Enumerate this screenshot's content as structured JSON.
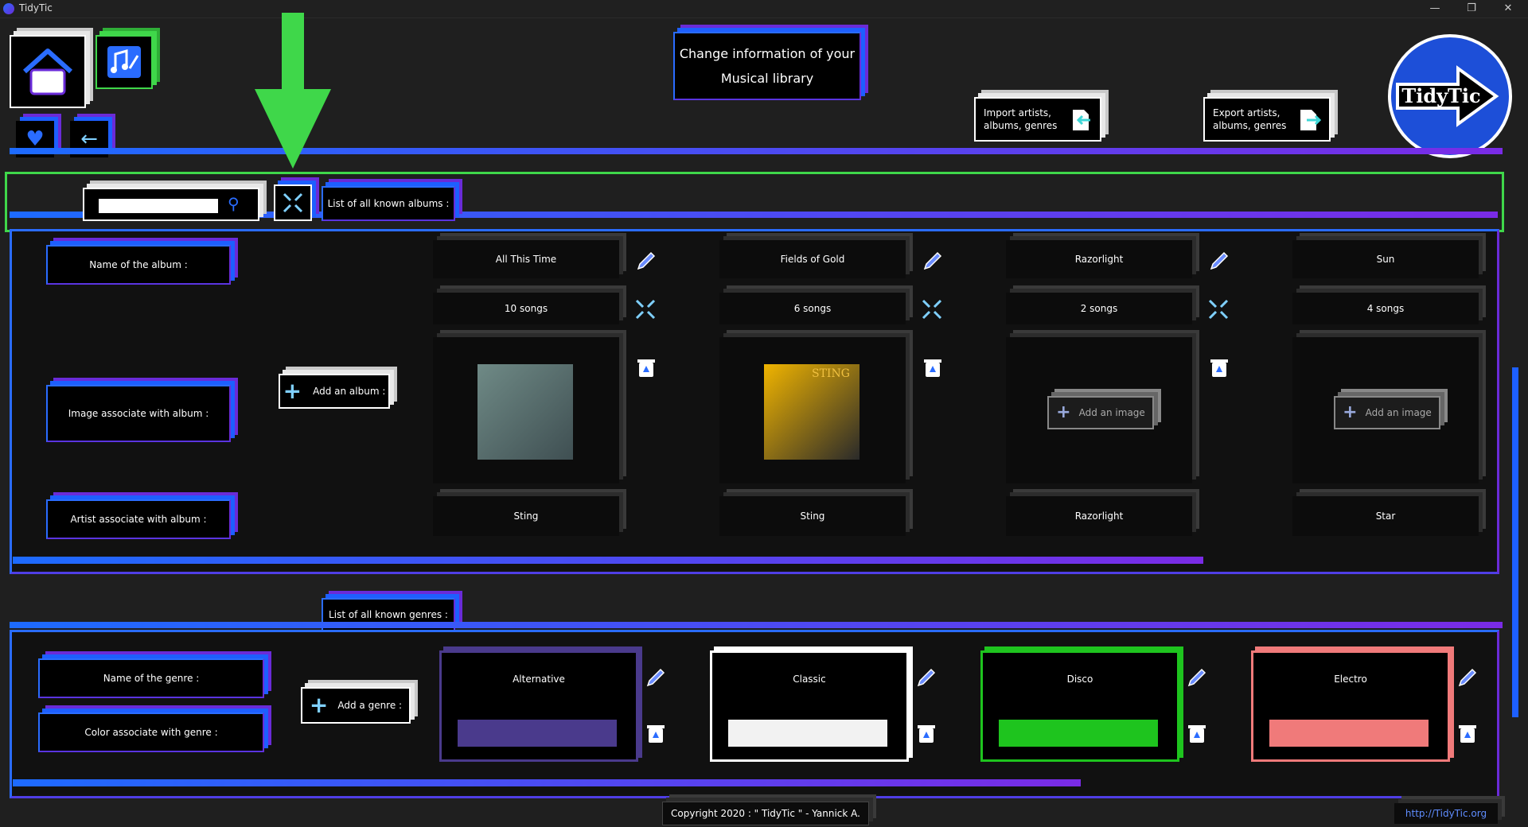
{
  "window": {
    "title": "TidyTic",
    "controls": [
      "—",
      "❐",
      "✕"
    ]
  },
  "header": {
    "banner_line1": "Change information of your",
    "banner_line2": "Musical library",
    "import_label_1": "Import artists,",
    "import_label_2": "albums, genres",
    "export_label_1": "Export artists,",
    "export_label_2": "albums, genres",
    "logo_text": "TidyTic"
  },
  "albums_section": {
    "tab_label": "List of all known albums :",
    "search": {
      "value": "",
      "placeholder": ""
    },
    "row_labels": {
      "name": "Name of the album :",
      "image": "Image associate with album :",
      "artist": "Artist associate with album :"
    },
    "add_album_label": "Add an album :",
    "add_image_label": "Add an image",
    "scroll_fraction": 0.82,
    "albums": [
      {
        "name": "All This Time",
        "songs": "10 songs",
        "artist": "Sting",
        "has_image": true,
        "cover_colors": [
          "#6f8a86",
          "#3f4f52"
        ]
      },
      {
        "name": "Fields of Gold",
        "songs": "6 songs",
        "artist": "Sting",
        "has_image": true,
        "cover_colors": [
          "#f0b400",
          "#2a2a2a"
        ],
        "cover_text": "STING"
      },
      {
        "name": "Razorlight",
        "songs": "2 songs",
        "artist": "Razorlight",
        "has_image": false
      },
      {
        "name": "Sun",
        "songs": "4 songs",
        "artist": "Star",
        "has_image": false
      }
    ]
  },
  "genres_section": {
    "tab_label": "List of all known genres :",
    "row_labels": {
      "name": "Name of the genre :",
      "color": "Color associate with genre :"
    },
    "add_genre_label": "Add a genre :",
    "scroll_fraction": 0.72,
    "genres": [
      {
        "name": "Alternative",
        "color": "#4a3a8c",
        "border": "#4a3a8c"
      },
      {
        "name": "Classic",
        "color": "#f2f2f2",
        "border": "#ffffff"
      },
      {
        "name": "Disco",
        "color": "#1ec41e",
        "border": "#1ec41e"
      },
      {
        "name": "Electro",
        "color": "#f07a7a",
        "border": "#f07a7a"
      }
    ]
  },
  "footer": {
    "copyright": "Copyright 2020 : \" TidyTic \" - Yannick A.",
    "link": "http://TidyTic.org"
  },
  "colors": {
    "accent_blue": "#1d6bff",
    "accent_purple": "#6a2bd8",
    "highlight_green": "#3fd74a",
    "background": "#1f1f1f"
  }
}
